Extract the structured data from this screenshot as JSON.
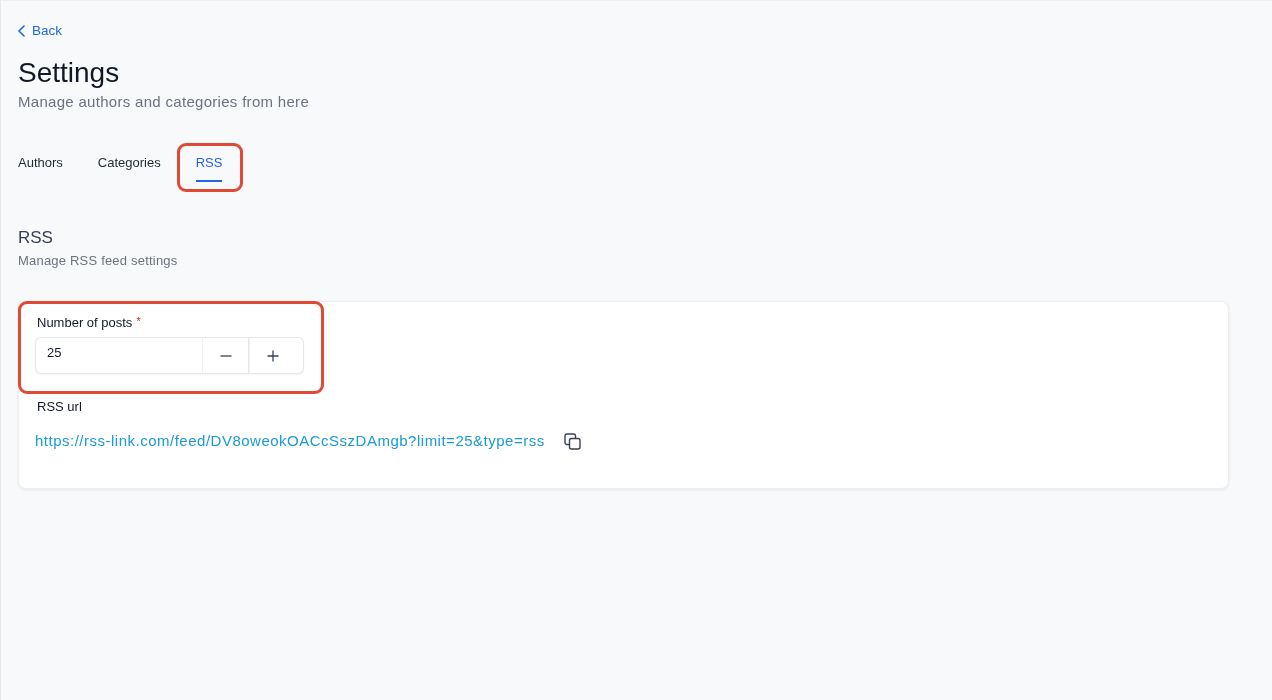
{
  "back_link": {
    "label": "Back"
  },
  "header": {
    "title": "Settings",
    "subtitle": "Manage authors and categories from here"
  },
  "tabs": [
    {
      "label": "Authors",
      "selected": false,
      "highlighted": false
    },
    {
      "label": "Categories",
      "selected": false,
      "highlighted": false
    },
    {
      "label": "RSS",
      "selected": true,
      "highlighted": true
    }
  ],
  "section": {
    "title": "RSS",
    "subtitle": "Manage RSS feed settings"
  },
  "posts_field": {
    "label": "Number of posts",
    "required_mark": "*",
    "value": "25",
    "highlighted": true
  },
  "rss_url": {
    "label": "RSS url",
    "link": "https://rss-link.com/feed/DV8oweokOACcSszDAmgb?limit=25&type=rss"
  }
}
